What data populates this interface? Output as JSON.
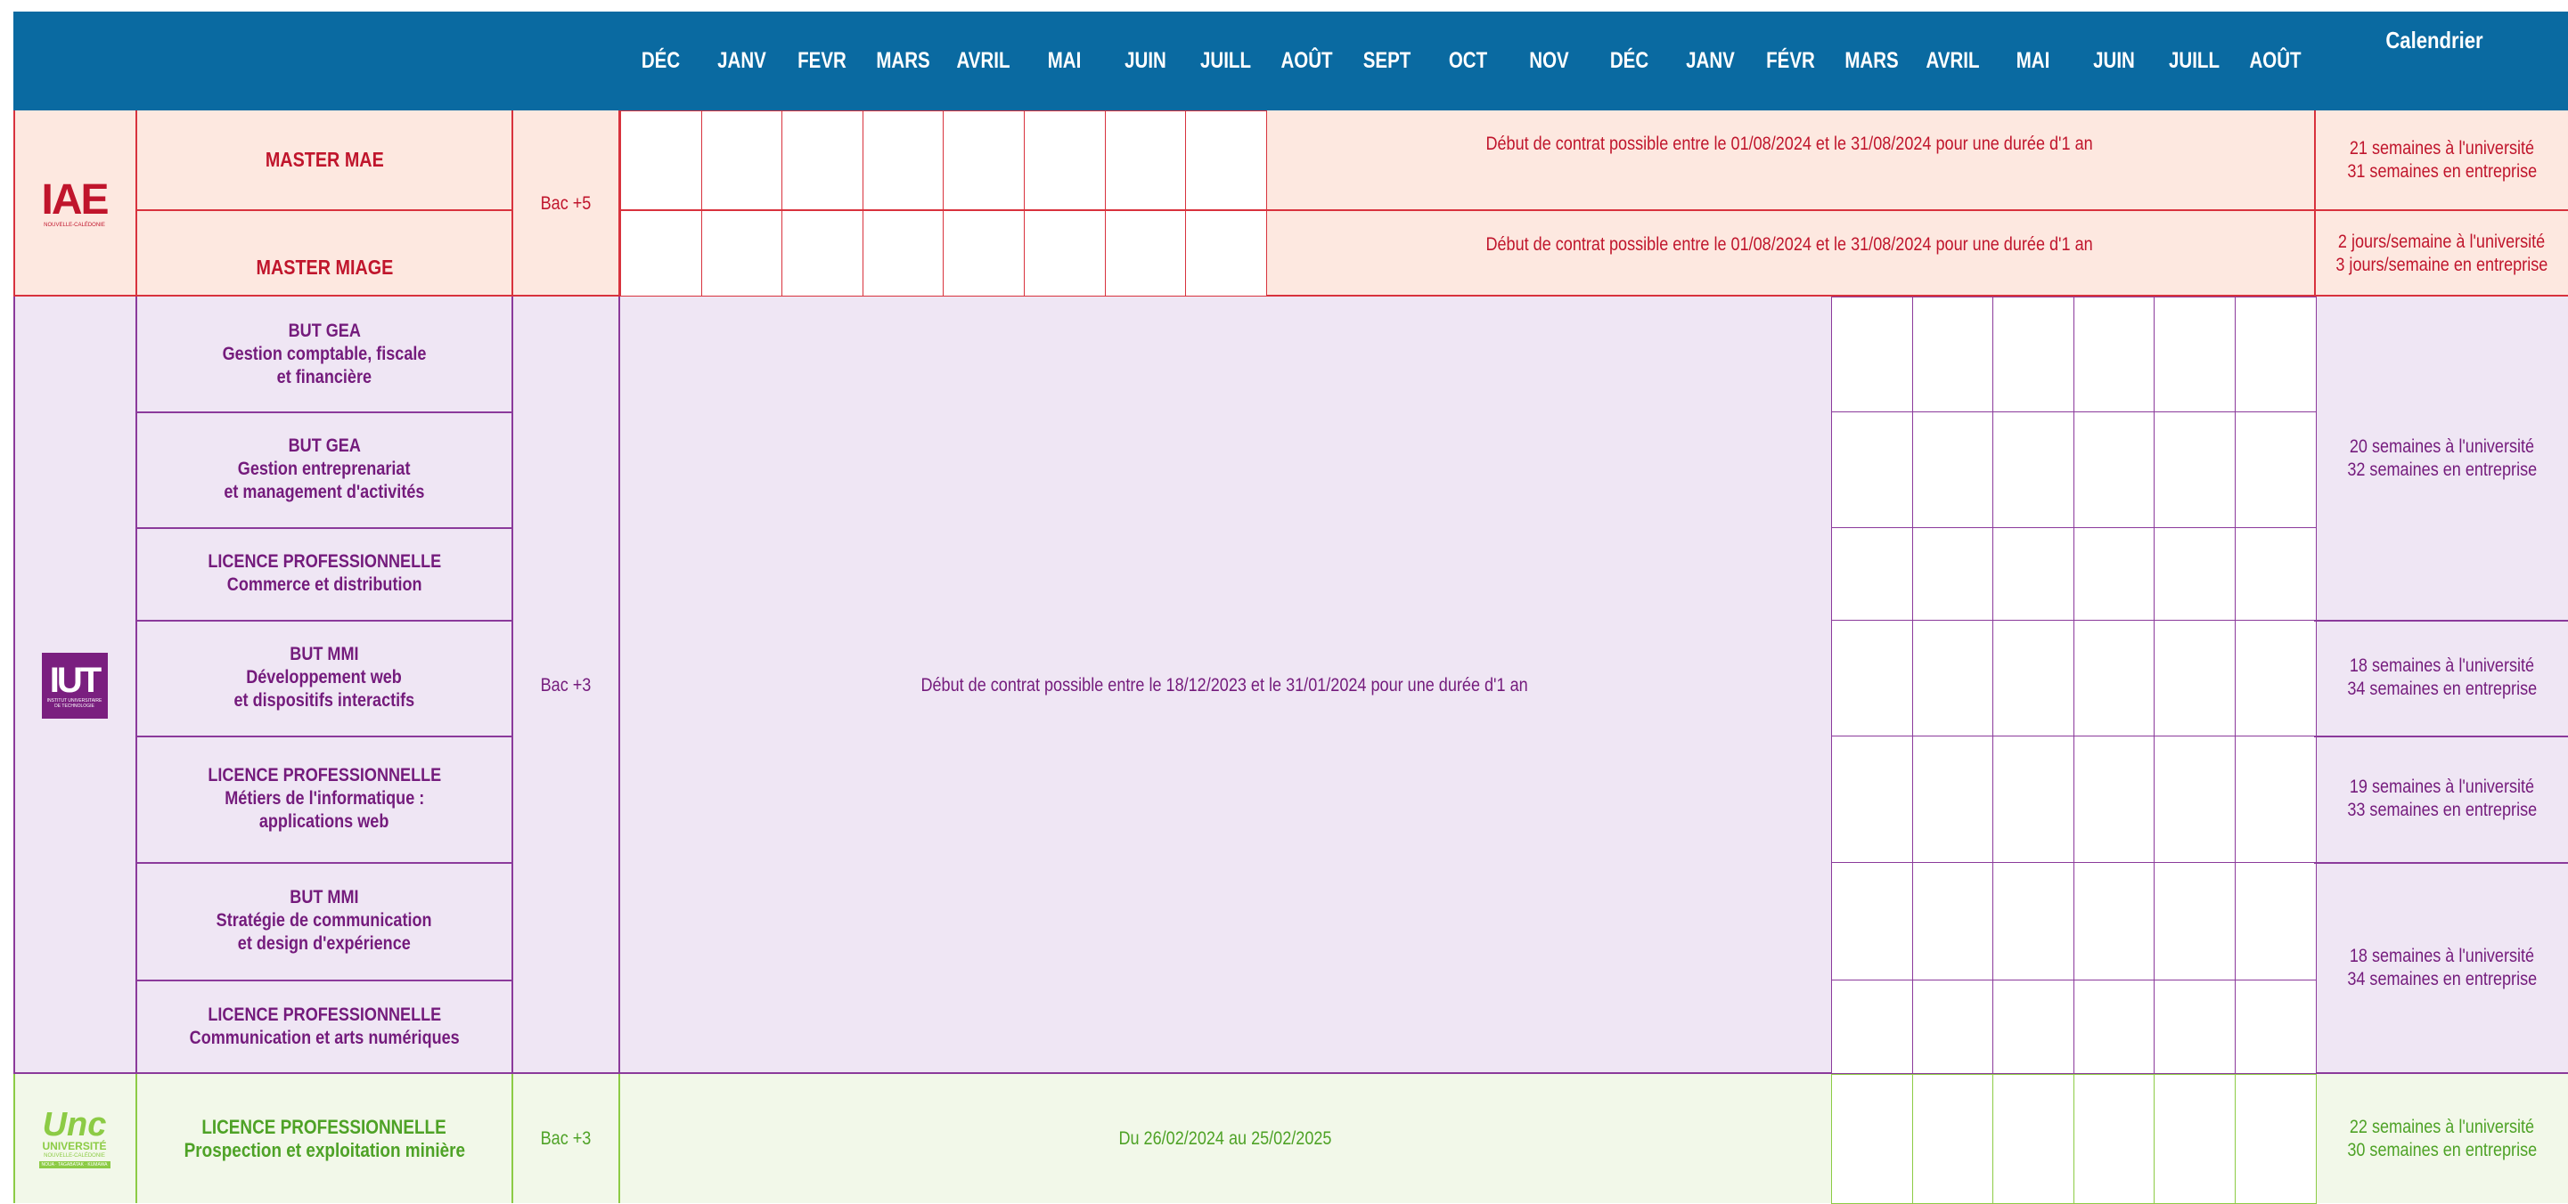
{
  "header": {
    "months": [
      "DÉC",
      "JANV",
      "FEVR",
      "MARS",
      "AVRIL",
      "MAI",
      "JUIN",
      "JUILL",
      "AOÛT",
      "SEPT",
      "OCT",
      "NOV",
      "DÉC",
      "JANV",
      "FÉVR",
      "MARS",
      "AVRIL",
      "MAI",
      "JUIN",
      "JUILL",
      "AOÛT"
    ],
    "calendar_label": "Calendrier"
  },
  "iae": {
    "logo_text": "IAE",
    "logo_subtext": "NOUVELLE-CALÉDONIE",
    "level": "Bac +5",
    "programs": [
      {
        "name": "MASTER MAE",
        "contract": "Début de contrat possible entre le 01/08/2024 et le 31/08/2024 pour une durée d'1 an",
        "calendar": [
          "21 semaines à l'université",
          "31 semaines en entreprise"
        ]
      },
      {
        "name": "MASTER MIAGE",
        "contract": "Début de contrat possible entre le 01/08/2024 et le 31/08/2024 pour une durée d'1 an",
        "calendar": [
          "2 jours/semaine à l'université",
          "3 jours/semaine en entreprise"
        ]
      }
    ]
  },
  "iut": {
    "logo_text": "IUT",
    "logo_subtext": "INSTITUT UNIVERSITAIRE DE TECHNOLOGIE",
    "level": "Bac +3",
    "contract": "Début de contrat possible entre le 18/12/2023 et le 31/01/2024 pour une durée d'1 an",
    "programs": [
      [
        "BUT GEA",
        "Gestion comptable, fiscale",
        "et financière"
      ],
      [
        "BUT GEA",
        "Gestion entreprenariat",
        "et management d'activités"
      ],
      [
        "LICENCE PROFESSIONNELLE",
        "Commerce et distribution"
      ],
      [
        "BUT MMI",
        "Développement web",
        "et dispositifs interactifs"
      ],
      [
        "LICENCE PROFESSIONNELLE",
        "Métiers de l'informatique :",
        "applications web"
      ],
      [
        "BUT MMI",
        "Stratégie de communication",
        "et design d'expérience"
      ],
      [
        "LICENCE PROFESSIONNELLE",
        "Communication et arts numériques"
      ]
    ],
    "calendars": [
      [
        "20 semaines à l'université",
        "32 semaines en entreprise"
      ],
      [
        "18 semaines à l'université",
        "34 semaines en entreprise"
      ],
      [
        "19 semaines à l'université",
        "33 semaines en entreprise"
      ],
      [
        "18 semaines à l'université",
        "34 semaines en entreprise"
      ]
    ]
  },
  "unc": {
    "logo_text": "Unc",
    "logo_subtext": "UNIVERSITÉ",
    "logo_subtext2": "NOUVELLE-CALÉDONIE",
    "logo_tag": "NOUA · TAGABATAK · KUMAWA",
    "level": "Bac +3",
    "program": [
      "LICENCE PROFESSIONNELLE",
      "Prospection et exploitation minière"
    ],
    "contract": "Du 26/02/2024 au 25/02/2025",
    "calendar": [
      "22 semaines à l'université",
      "30 semaines en entreprise"
    ]
  },
  "colors": {
    "header_blue": "#0a6aa1",
    "iae_red": "#c0152c",
    "iut_purple": "#741b7c",
    "unc_green": "#4ea226"
  }
}
